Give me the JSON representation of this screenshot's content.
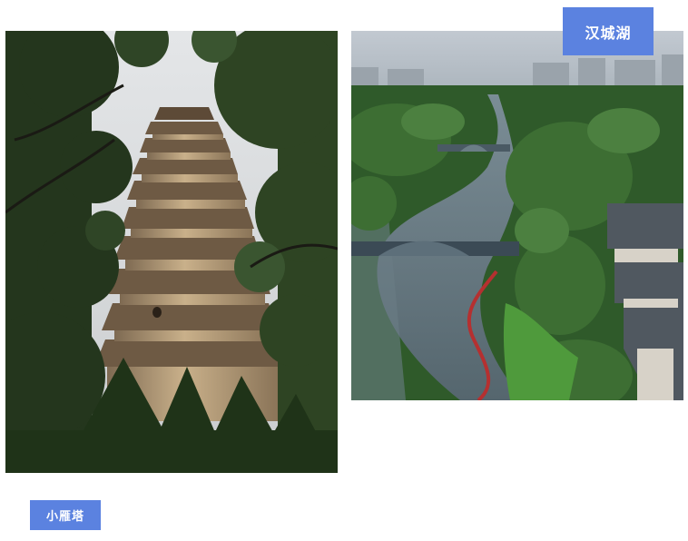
{
  "photos": [
    {
      "caption": "小雁塔"
    },
    {
      "caption": "汉城湖"
    }
  ]
}
